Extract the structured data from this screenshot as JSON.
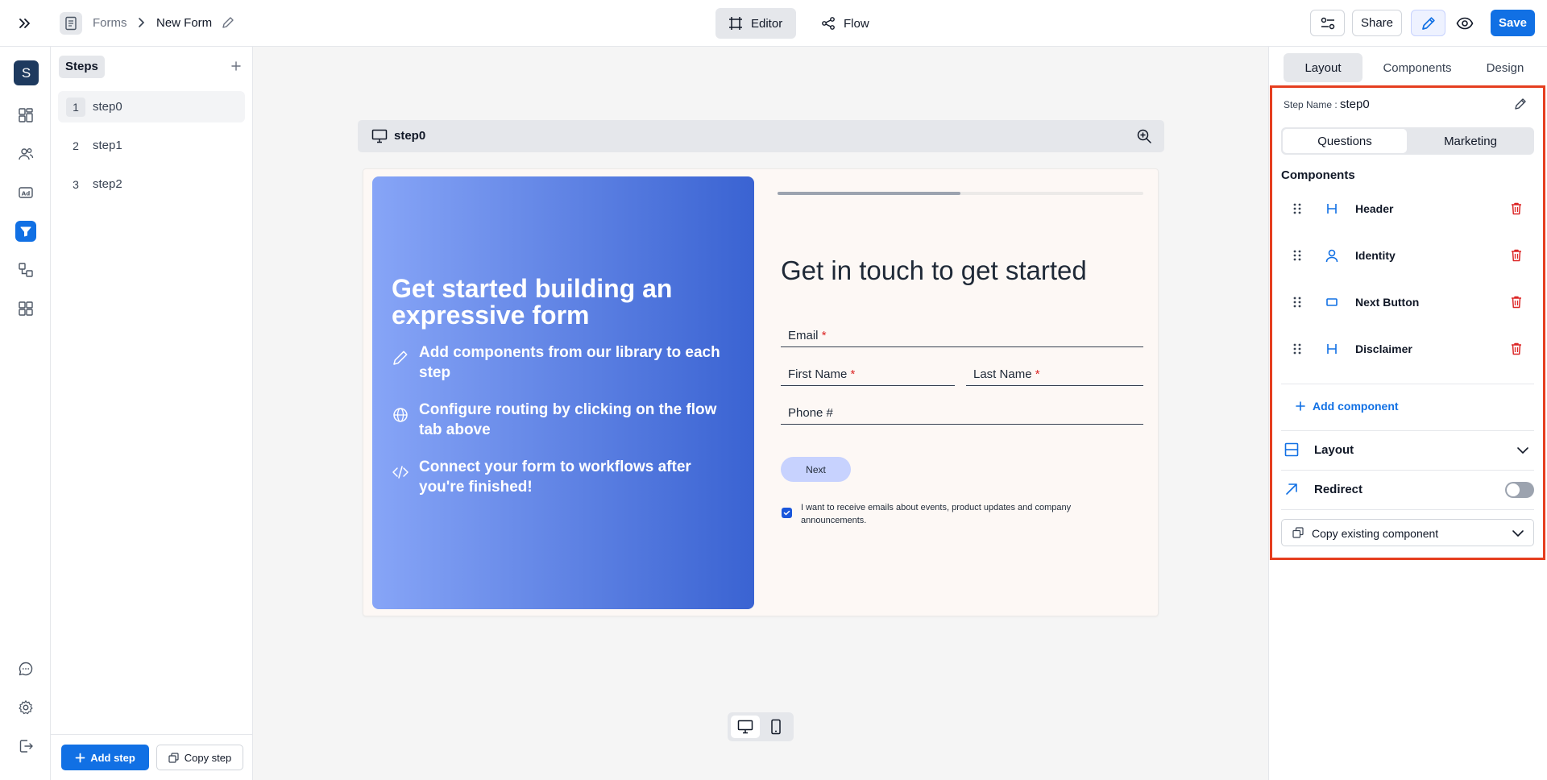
{
  "breadcrumb": {
    "parent": "Forms",
    "current": "New Form"
  },
  "modes": {
    "editor": "Editor",
    "flow": "Flow"
  },
  "toolbar": {
    "share": "Share",
    "save": "Save"
  },
  "rail": {
    "avatar": "S"
  },
  "steps": {
    "header": "Steps",
    "items": [
      {
        "num": "1",
        "label": "step0"
      },
      {
        "num": "2",
        "label": "step1"
      },
      {
        "num": "3",
        "label": "step2"
      }
    ],
    "add_label": "Add step",
    "copy_label": "Copy step"
  },
  "canvas": {
    "step_title": "step0",
    "hero": {
      "title": "Get started building an expressive form",
      "items": [
        "Add components from our library to each step",
        "Configure routing by clicking on the flow tab above",
        "Connect your form to workflows after you're finished!"
      ]
    },
    "progress": 0.5,
    "form_title": "Get in touch to get started",
    "fields": {
      "email": "Email",
      "first_name": "First Name",
      "last_name": "Last Name",
      "phone": "Phone #"
    },
    "required_mark": "*",
    "next": "Next",
    "consent": "I want to receive emails about events, product updates and company announcements."
  },
  "panel": {
    "tabs": [
      "Layout",
      "Components",
      "Design"
    ],
    "step_name_label": "Step Name :",
    "step_name_value": "step0",
    "segments": [
      "Questions",
      "Marketing"
    ],
    "components_heading": "Components",
    "components": [
      {
        "label": "Header",
        "icon": "heading-icon"
      },
      {
        "label": "Identity",
        "icon": "person-icon"
      },
      {
        "label": "Next Button",
        "icon": "button-icon"
      },
      {
        "label": "Disclaimer",
        "icon": "heading-icon"
      }
    ],
    "add_component": "Add component",
    "layout_label": "Layout",
    "redirect_label": "Redirect",
    "redirect_on": false,
    "copy_existing": "Copy existing component"
  },
  "colors": {
    "accent": "#1170e4",
    "highlight": "#e53e1f",
    "delete": "#dc2626"
  }
}
